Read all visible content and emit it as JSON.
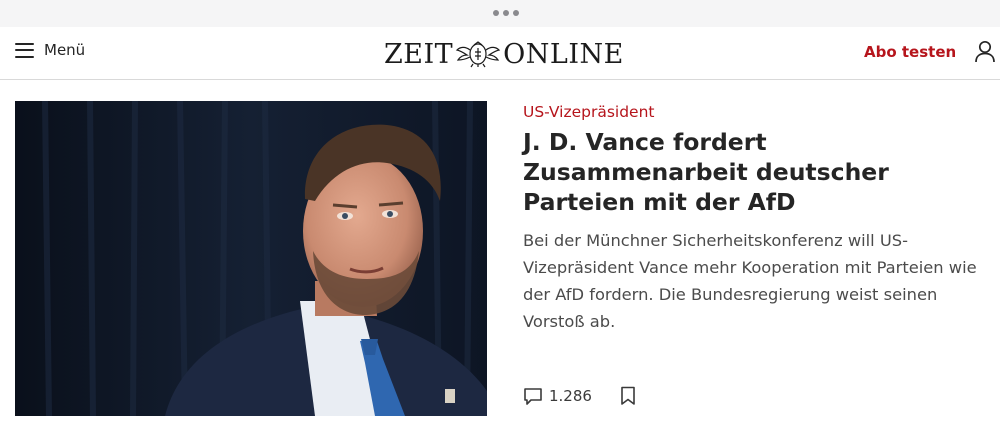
{
  "header": {
    "menu_label": "Menü",
    "logo_left": "ZEIT",
    "logo_right": "ONLINE",
    "subscribe_label": "Abo testen"
  },
  "article": {
    "kicker": "US-Vizepräsident",
    "headline": "J. D. Vance fordert Zusammenarbeit deutscher Parteien mit der AfD",
    "teaser": "Bei der Münchner Sicherheitskonferenz will US-Vizepräsident Vance mehr Kooperation mit Parteien wie der AfD fordern. Die Bundesregierung weist seinen Vorstoß ab.",
    "comment_count": "1.286"
  },
  "colors": {
    "accent": "#b6151c",
    "text": "#252525",
    "teaser_text": "#4b4b4b",
    "divider": "#d9d9d9"
  },
  "icons": {
    "menu": "hamburger-icon",
    "user": "user-icon",
    "comments": "comment-bubble-icon",
    "bookmark": "bookmark-icon"
  }
}
